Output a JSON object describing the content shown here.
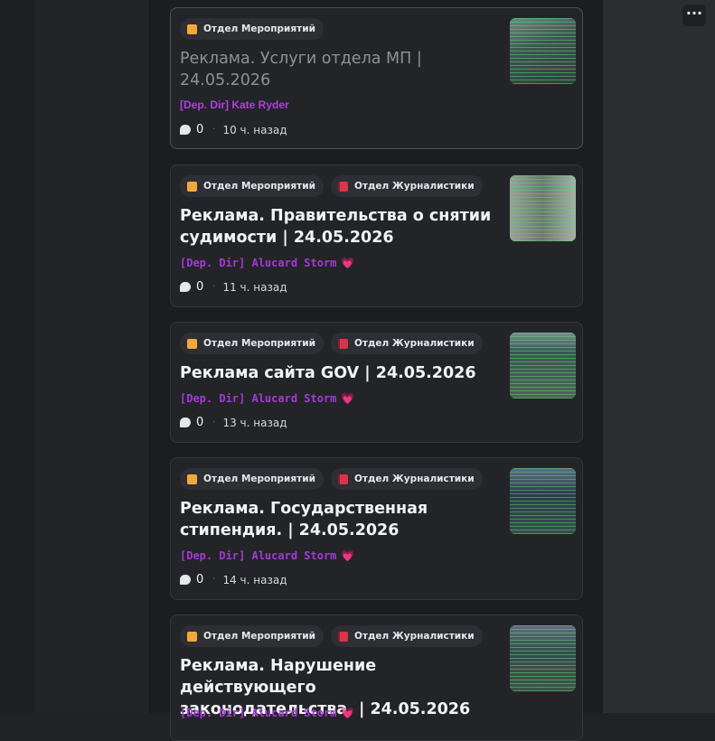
{
  "more_label": "···",
  "posts": [
    {
      "tags": [
        {
          "label": "Отдел Мероприятий",
          "icon": "orange-square-icon"
        }
      ],
      "title": "Реклама. Услуги отдела МП |\n24.05.2026",
      "author": "[Dep. Dir] Kate Ryder",
      "author_heart": "",
      "comments": "0",
      "time": "10 ч. назад"
    },
    {
      "tags": [
        {
          "label": "Отдел Мероприятий",
          "icon": "orange-square-icon"
        },
        {
          "label": "Отдел Журналистики",
          "icon": "red-book-icon"
        }
      ],
      "title": "Реклама. Правительства о снятии\nсудимости | 24.05.2026",
      "author": "[Dep. Dir] Alucard Storm",
      "author_heart": "💗",
      "comments": "0",
      "time": "11 ч. назад"
    },
    {
      "tags": [
        {
          "label": "Отдел Мероприятий",
          "icon": "orange-square-icon"
        },
        {
          "label": "Отдел Журналистики",
          "icon": "red-book-icon"
        }
      ],
      "title": "Реклама сайта GOV | 24.05.2026",
      "author": "[Dep. Dir] Alucard Storm",
      "author_heart": "💗",
      "comments": "0",
      "time": "13 ч. назад"
    },
    {
      "tags": [
        {
          "label": "Отдел Мероприятий",
          "icon": "orange-square-icon"
        },
        {
          "label": "Отдел Журналистики",
          "icon": "red-book-icon"
        }
      ],
      "title": "Реклама. Государственная\nстипендия. | 24.05.2026",
      "author": "[Dep. Dir] Alucard Storm",
      "author_heart": "💗",
      "comments": "0",
      "time": "14 ч. назад"
    },
    {
      "tags": [
        {
          "label": "Отдел Мероприятий",
          "icon": "orange-square-icon"
        },
        {
          "label": "Отдел Журналистики",
          "icon": "red-book-icon"
        }
      ],
      "title": "Реклама. Нарушение действующего\nзаконодательства. | 24.05.2026",
      "author": "[Dep. Dir] Alucard Storm",
      "author_heart": "💗",
      "comments": "",
      "time": ""
    }
  ]
}
